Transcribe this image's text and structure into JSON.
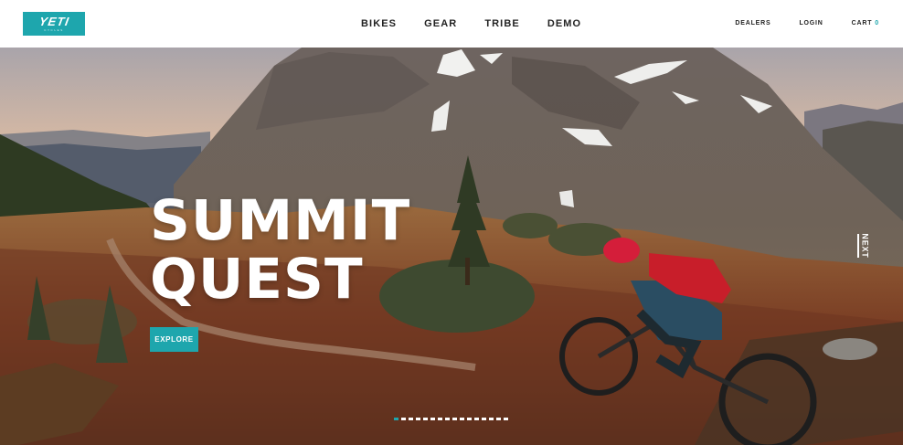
{
  "colors": {
    "accent": "#1ea6ad"
  },
  "logo": {
    "text": "YETI",
    "subtext": "CYCLES"
  },
  "nav": {
    "main": [
      {
        "label": "BIKES"
      },
      {
        "label": "GEAR"
      },
      {
        "label": "TRIBE"
      },
      {
        "label": "DEMO"
      }
    ],
    "utility": {
      "dealers": "DEALERS",
      "login": "LOGIN",
      "cart": "CART",
      "cart_count": "0"
    }
  },
  "hero": {
    "title_line1": "SUMMIT",
    "title_line2": "QUEST",
    "cta": "EXPLORE",
    "next": "NEXT",
    "slide_count": 16,
    "active_slide": 1
  }
}
